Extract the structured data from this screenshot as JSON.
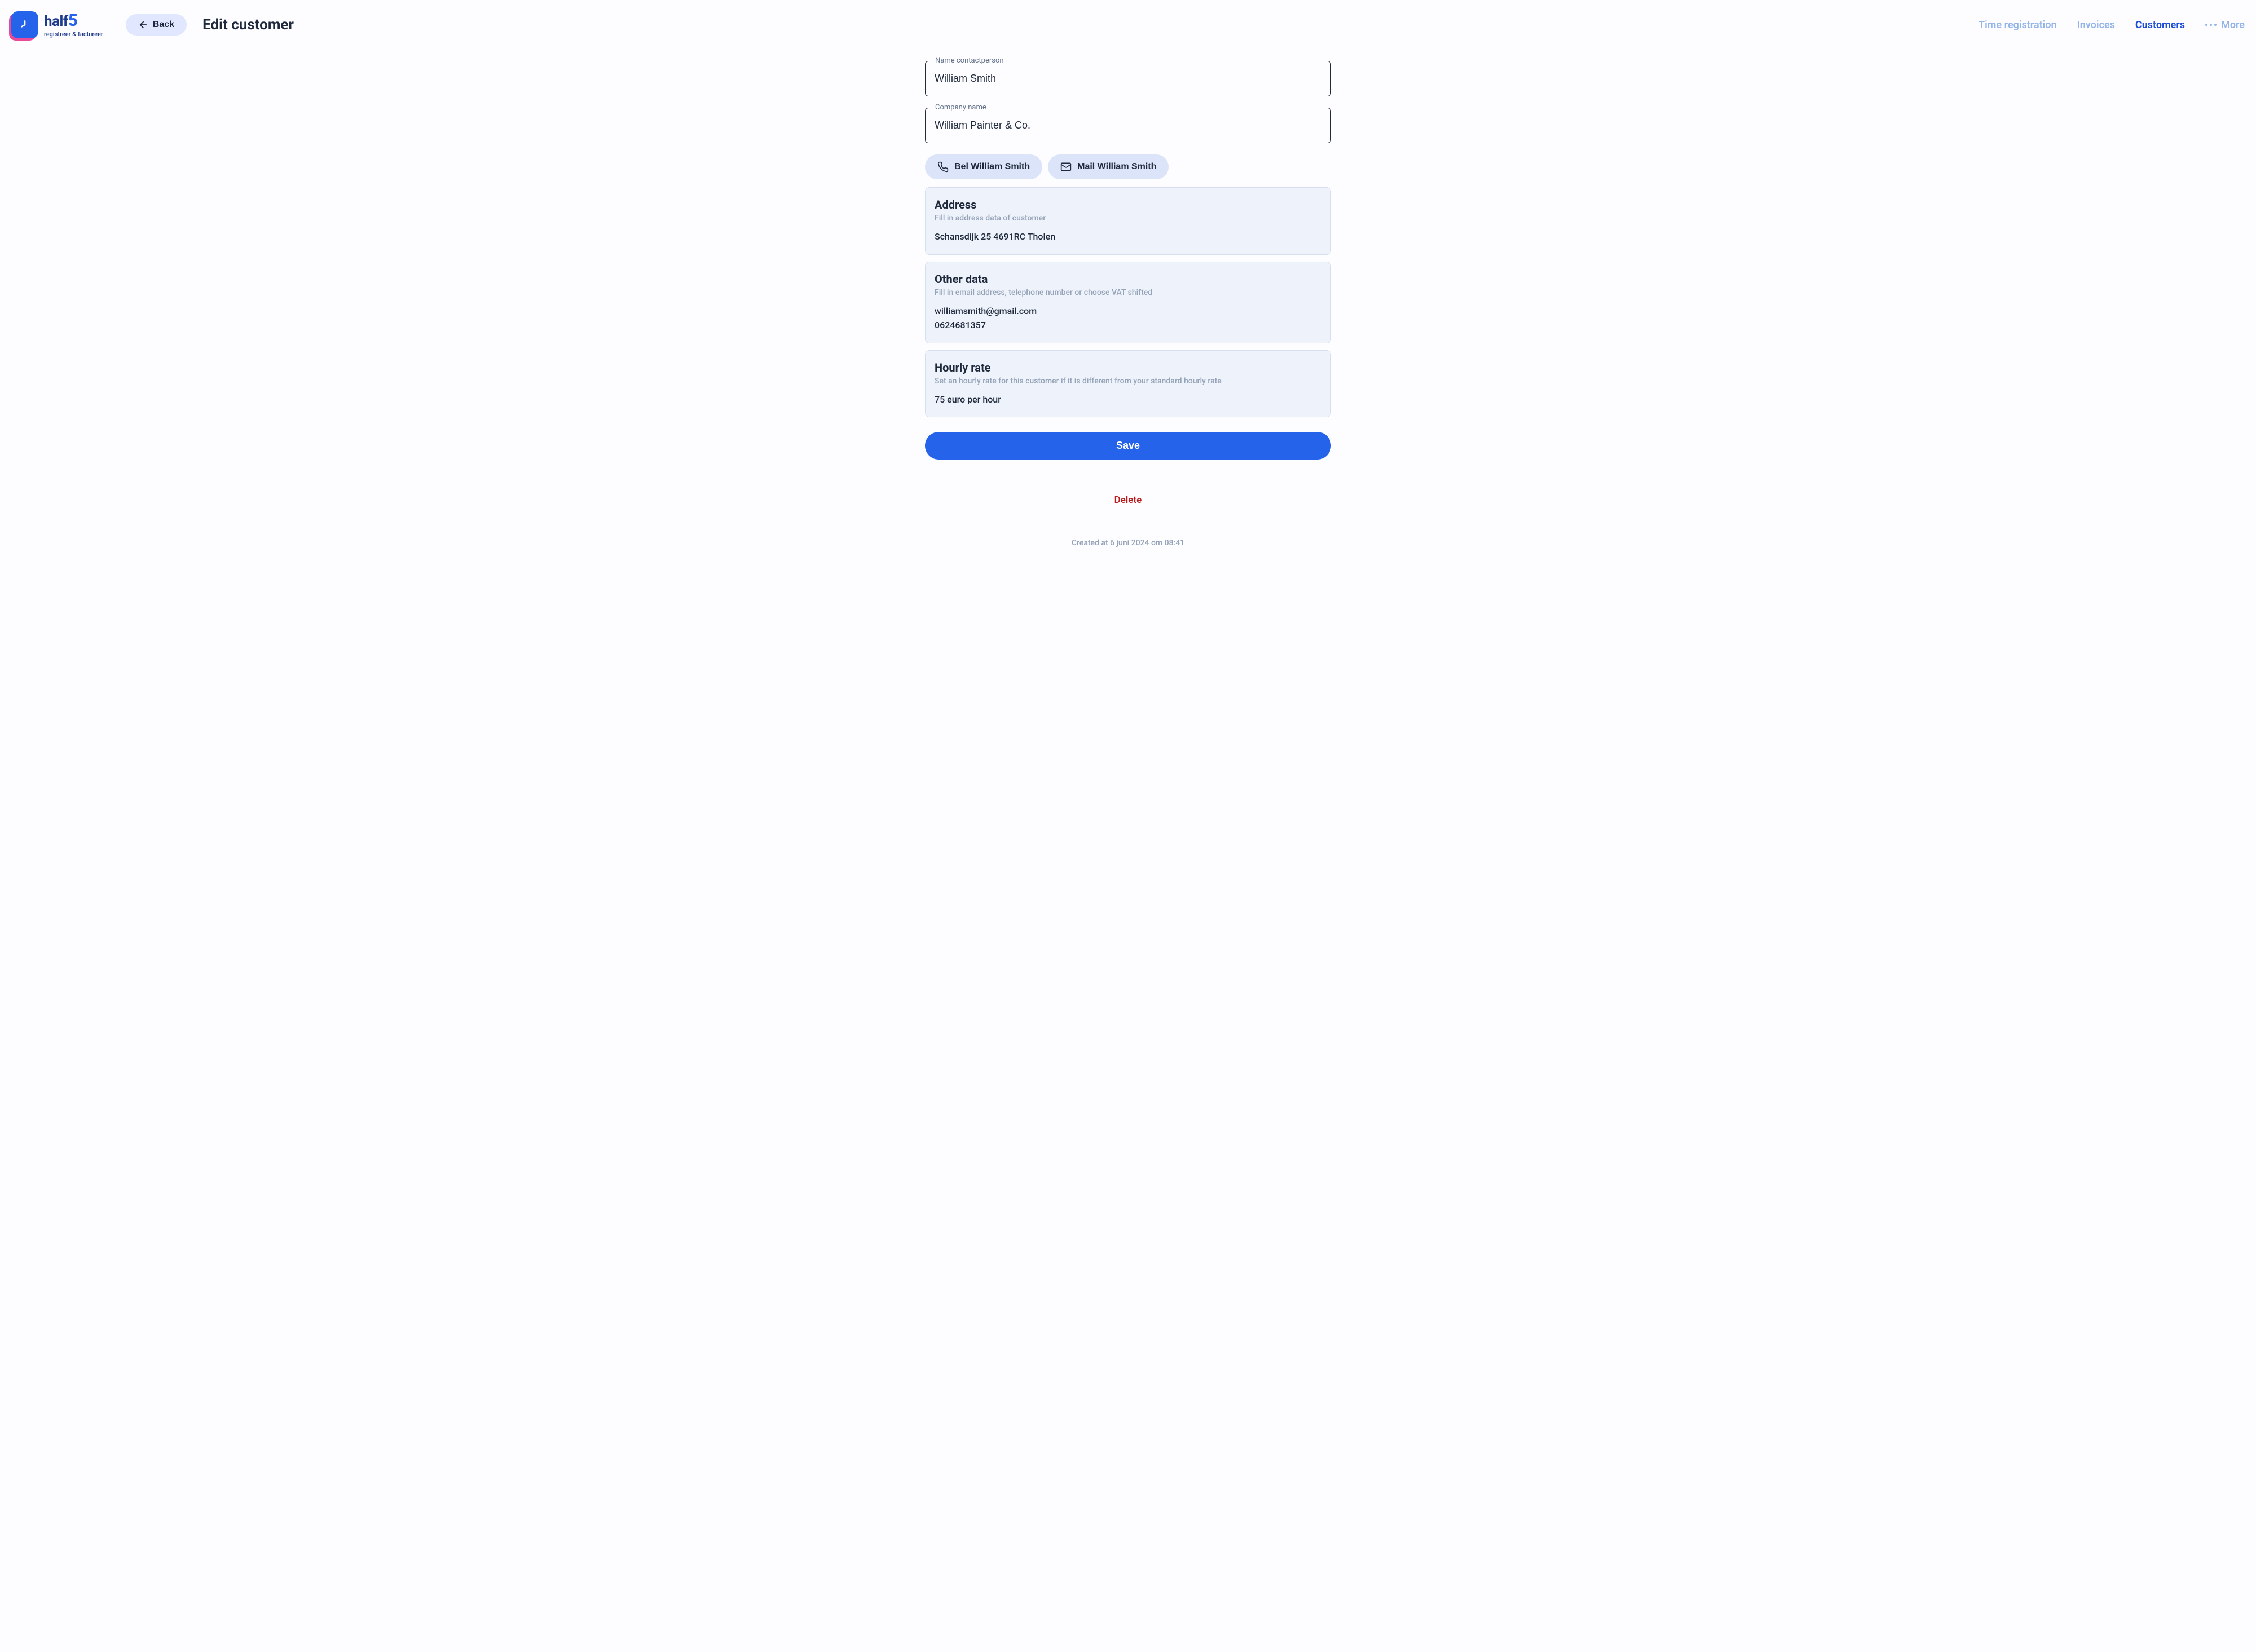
{
  "logo": {
    "title_part1": "half",
    "title_part2": "5",
    "subtitle": "registreer & factureer"
  },
  "header": {
    "back_label": "Back",
    "page_title": "Edit customer"
  },
  "nav": {
    "items": [
      {
        "label": "Time registration",
        "active": false
      },
      {
        "label": "Invoices",
        "active": false
      },
      {
        "label": "Customers",
        "active": true
      }
    ],
    "more_label": "More"
  },
  "form": {
    "contact_name_label": "Name contactperson",
    "contact_name_value": "William Smith",
    "company_name_label": "Company name",
    "company_name_value": "William Painter & Co."
  },
  "actions": {
    "call_label": "Bel William Smith",
    "mail_label": "Mail William Smith"
  },
  "cards": {
    "address": {
      "title": "Address",
      "subtitle": "Fill in address data of customer",
      "value": "Schansdijk 25 4691RC Tholen"
    },
    "other": {
      "title": "Other data",
      "subtitle": "Fill in email address, telephone number or choose VAT shifted",
      "email": "williamsmith@gmail.com",
      "phone": "0624681357"
    },
    "rate": {
      "title": "Hourly rate",
      "subtitle": "Set an hourly rate for this customer if it is different from your standard hourly rate",
      "value": "75 euro per hour"
    }
  },
  "buttons": {
    "save_label": "Save",
    "delete_label": "Delete"
  },
  "meta": {
    "created_text": "Created at 6 juni 2024 om 08:41"
  }
}
